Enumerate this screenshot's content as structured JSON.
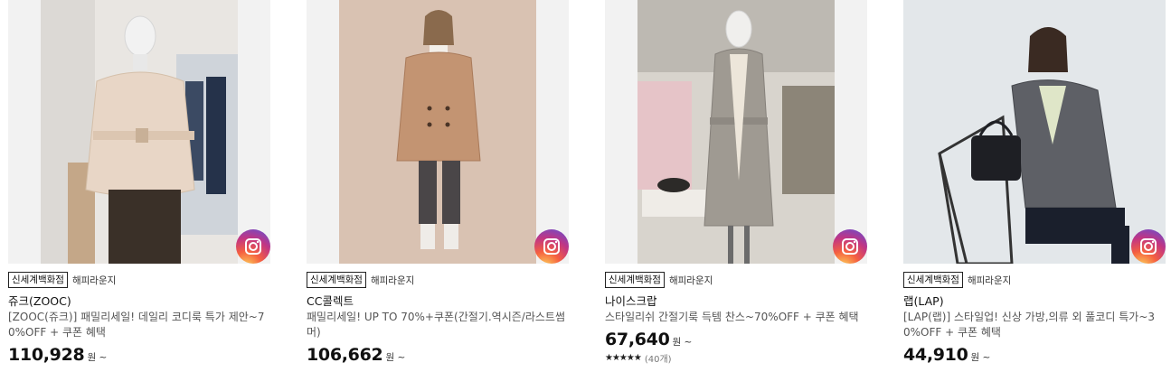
{
  "colors": {
    "price": "#111111",
    "store_tag_border": "#222222",
    "accent_gradient": [
      "#fdd65a",
      "#f56040",
      "#c13584",
      "#5b51d8"
    ]
  },
  "products": [
    {
      "store": "신세계백화점",
      "store_sub": "해피라운지",
      "brand": "쥬크(ZOOC)",
      "desc": "[ZOOC(쥬크)] 패밀리세일! 데일리 코디룩 특가 제안~70%OFF + 쿠폰 혜택",
      "price": "110,928",
      "unit": "원 ~",
      "image_icon": "camera-lens-icon"
    },
    {
      "store": "신세계백화점",
      "store_sub": "해피라운지",
      "brand": "CC콜렉트",
      "desc": "패밀리세일! UP TO 70%+쿠폰(간절기.역시즌/라스트썸머)",
      "price": "106,662",
      "unit": "원 ~",
      "image_icon": "camera-lens-icon"
    },
    {
      "store": "신세계백화점",
      "store_sub": "해피라운지",
      "brand": "나이스크랍",
      "desc": "스타일리쉬 간절기룩 득템 찬스~70%OFF + 쿠폰 혜택",
      "price": "67,640",
      "unit": "원 ~",
      "rating_stars": "★★★★★",
      "rating_count": "(40개)",
      "image_icon": "camera-lens-icon"
    },
    {
      "store": "신세계백화점",
      "store_sub": "해피라운지",
      "brand": "랩(LAP)",
      "desc": "[LAP(랩)] 스타일업! 신상 가방,의류 외 풀코디 특가~30%OFF + 쿠폰 혜택",
      "price": "44,910",
      "unit": "원 ~",
      "image_icon": "camera-lens-icon"
    }
  ]
}
